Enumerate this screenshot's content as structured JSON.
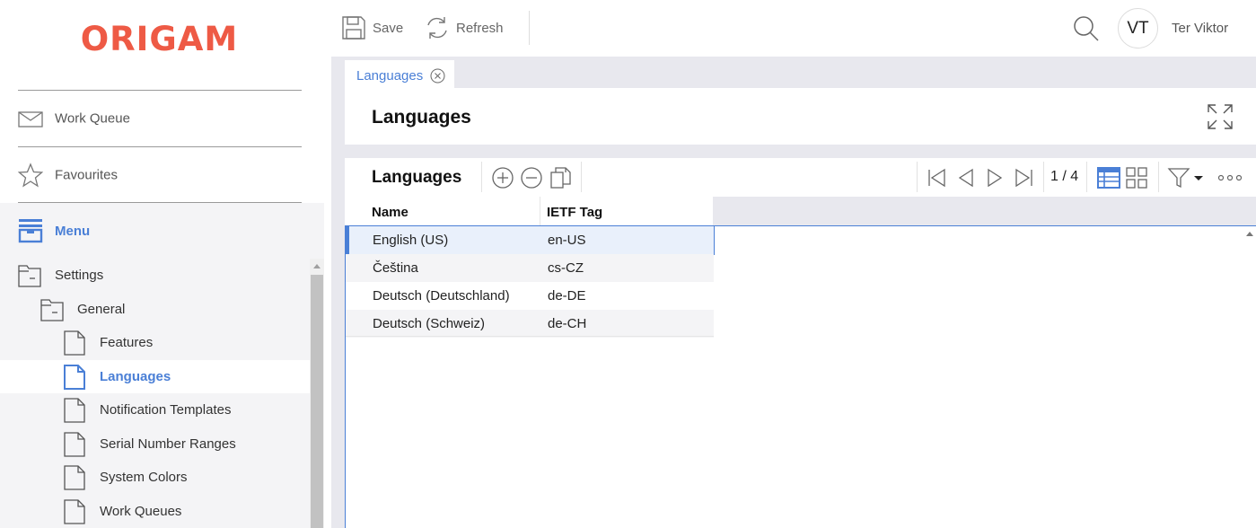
{
  "app": {
    "logo": "ORIGAM"
  },
  "sidebar": {
    "work_queue": "Work Queue",
    "favourites": "Favourites",
    "menu": "Menu",
    "tree": [
      {
        "label": "Settings",
        "icon": "folder-icon"
      },
      {
        "label": "General",
        "icon": "folder-icon"
      },
      {
        "label": "Features",
        "icon": "document-icon"
      },
      {
        "label": "Languages",
        "icon": "document-icon",
        "active": true
      },
      {
        "label": "Notification Templates",
        "icon": "document-icon"
      },
      {
        "label": "Serial Number Ranges",
        "icon": "document-icon"
      },
      {
        "label": "System Colors",
        "icon": "document-icon"
      },
      {
        "label": "Work Queues",
        "icon": "document-icon"
      }
    ]
  },
  "toolbar": {
    "save_label": "Save",
    "refresh_label": "Refresh"
  },
  "user": {
    "initials": "VT",
    "name": "Ter Viktor"
  },
  "tabs": [
    {
      "label": "Languages"
    }
  ],
  "form": {
    "title": "Languages"
  },
  "panel": {
    "title": "Languages",
    "pager": "1 / 4",
    "columns": [
      "Name",
      "IETF Tag"
    ],
    "rows": [
      [
        "English (US)",
        "en-US"
      ],
      [
        "Čeština",
        "cs-CZ"
      ],
      [
        "Deutsch (Deutschland)",
        "de-DE"
      ],
      [
        "Deutsch (Schweiz)",
        "de-CH"
      ]
    ]
  },
  "colors": {
    "brand": "#ee5a45",
    "accent": "#4a7fd6"
  }
}
